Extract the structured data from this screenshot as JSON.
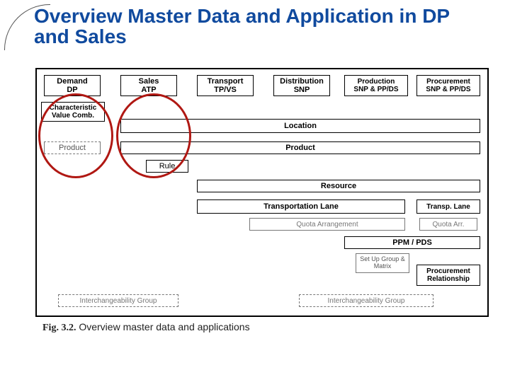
{
  "title": "Overview Master Data and Application in DP and Sales",
  "headers": {
    "h1": {
      "l1": "Demand",
      "l2": "DP"
    },
    "h2": {
      "l1": "Sales",
      "l2": "ATP"
    },
    "h3": {
      "l1": "Transport",
      "l2": "TP/VS"
    },
    "h4": {
      "l1": "Distribution",
      "l2": "SNP"
    },
    "h5": {
      "l1": "Production",
      "l2": "SNP & PP/DS"
    },
    "h6": {
      "l1": "Procurement",
      "l2": "SNP & PP/DS"
    }
  },
  "rows": {
    "cvc": "Characteristic Value Comb.",
    "location": "Location",
    "product_left": "Product",
    "product_right": "Product",
    "rule": "Rule",
    "resource": "Resource",
    "tlane": "Transportation Lane",
    "tlane_r": "Transp. Lane",
    "quota": "Quota Arrangement",
    "quota_r": "Quota Arr.",
    "ppm": "PPM / PDS",
    "setup": "Set Up Group & Matrix",
    "procrel": "Procurement Relationship",
    "inter_l": "Interchangeability Group",
    "inter_r": "Interchangeability Group"
  },
  "caption": {
    "fig": "Fig. 3.2.",
    "text": " Overview master data and applications"
  }
}
